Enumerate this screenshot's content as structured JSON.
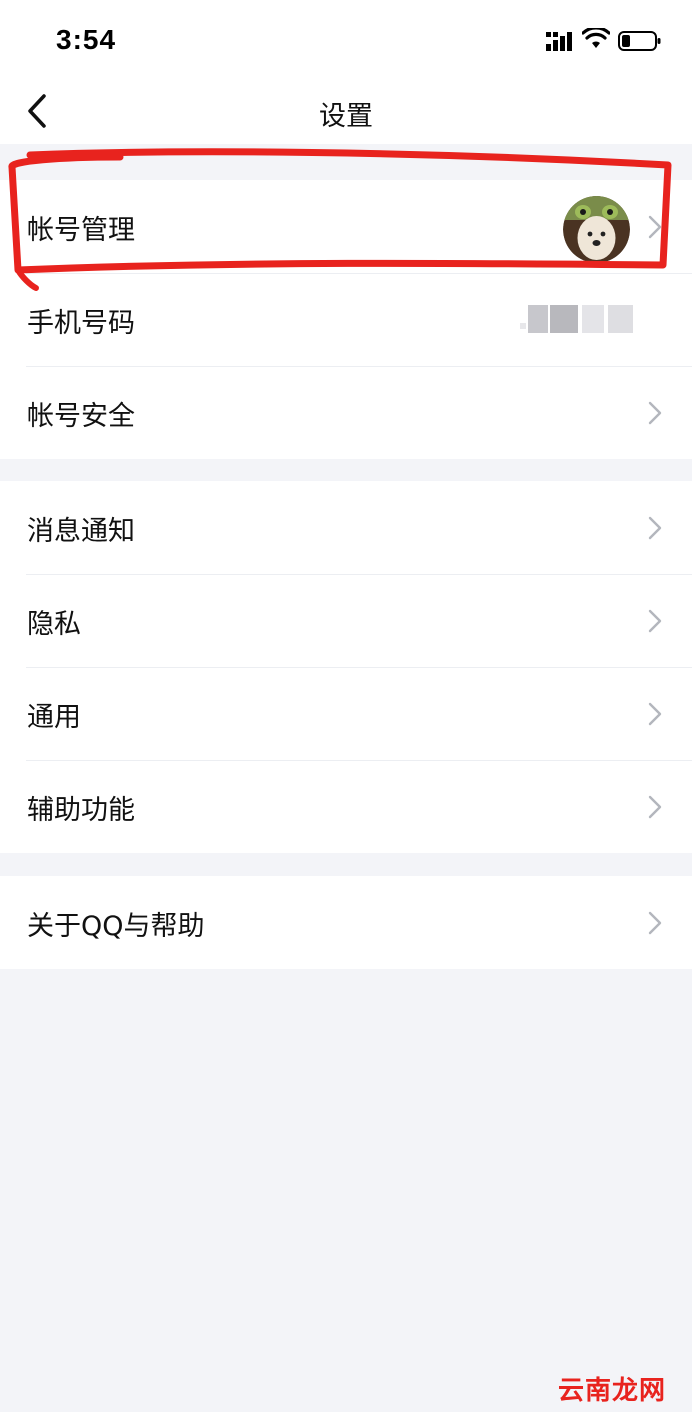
{
  "status_bar": {
    "time": "3:54"
  },
  "nav": {
    "title": "设置"
  },
  "groups": [
    {
      "items": [
        {
          "label": "帐号管理"
        },
        {
          "label": "手机号码"
        },
        {
          "label": "帐号安全"
        }
      ]
    },
    {
      "items": [
        {
          "label": "消息通知"
        },
        {
          "label": "隐私"
        },
        {
          "label": "通用"
        },
        {
          "label": "辅助功能"
        }
      ]
    },
    {
      "items": [
        {
          "label": "关于QQ与帮助"
        }
      ]
    }
  ],
  "colors": {
    "background": "#f3f4f8",
    "surface": "#ffffff",
    "chevron": "#b3b6bd",
    "annotation": "#e8231e"
  },
  "icons": [
    "signal-icon",
    "wifi-icon",
    "battery-icon",
    "back-arrow-icon",
    "chevron-right-icon"
  ],
  "watermark": "云南龙网"
}
